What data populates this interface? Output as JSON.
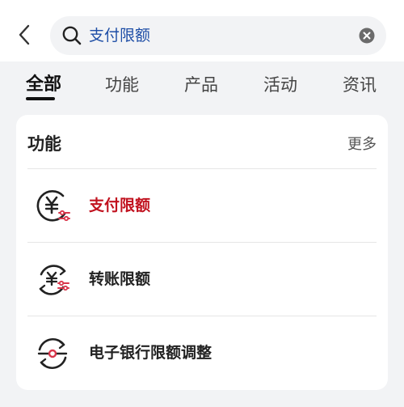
{
  "search": {
    "query": "支付限额"
  },
  "tabs": [
    {
      "label": "全部",
      "active": true
    },
    {
      "label": "功能",
      "active": false
    },
    {
      "label": "产品",
      "active": false
    },
    {
      "label": "活动",
      "active": false
    },
    {
      "label": "资讯",
      "active": false
    }
  ],
  "section": {
    "title": "功能",
    "more_label": "更多",
    "items": [
      {
        "label": "支付限额",
        "icon": "yuan-limit-icon",
        "highlighted": true
      },
      {
        "label": "转账限额",
        "icon": "transfer-limit-icon",
        "highlighted": false
      },
      {
        "label": "电子银行限额调整",
        "icon": "ebank-limit-adjust-icon",
        "highlighted": false
      }
    ]
  },
  "colors": {
    "accent_red": "#c1121f",
    "search_text": "#1e4ea6",
    "page_bg": "#f2f3f5"
  }
}
